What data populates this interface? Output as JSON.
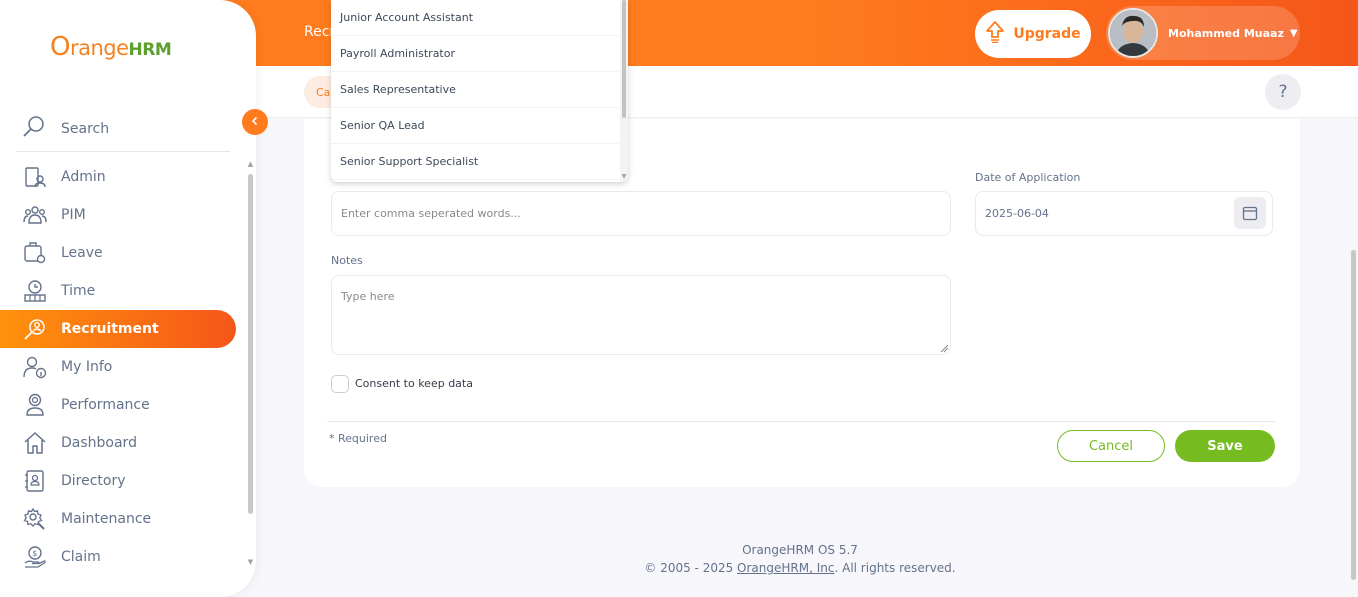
{
  "topbar": {
    "title": "Recr",
    "upgrade_label": "Upgrade",
    "user_name": "Mohammed Muaaz",
    "accent": "#ff7b1d"
  },
  "subbar": {
    "chip_label": "Ca",
    "help_label": "?"
  },
  "sidebar": {
    "logo_o": "O",
    "logo_range": "range",
    "logo_hrm": "HRM",
    "search_label": "Search",
    "items": [
      {
        "label": "Admin",
        "icon": "admin-icon"
      },
      {
        "label": "PIM",
        "icon": "pim-icon"
      },
      {
        "label": "Leave",
        "icon": "leave-icon"
      },
      {
        "label": "Time",
        "icon": "time-icon"
      },
      {
        "label": "Recruitment",
        "icon": "recruitment-icon",
        "active": true
      },
      {
        "label": "My Info",
        "icon": "my-info-icon"
      },
      {
        "label": "Performance",
        "icon": "performance-icon"
      },
      {
        "label": "Dashboard",
        "icon": "dashboard-icon"
      },
      {
        "label": "Directory",
        "icon": "directory-icon"
      },
      {
        "label": "Maintenance",
        "icon": "maintenance-icon"
      },
      {
        "label": "Claim",
        "icon": "claim-icon"
      }
    ]
  },
  "dropdown": {
    "options": [
      "Junior Account Assistant",
      "Payroll Administrator",
      "Sales Representative",
      "Senior QA Lead",
      "Senior Support Specialist"
    ]
  },
  "form": {
    "keywords_placeholder": "Enter comma seperated words...",
    "date_label": "Date of Application",
    "date_value": "2025-06-04",
    "notes_label": "Notes",
    "notes_placeholder": "Type here",
    "consent_label": "Consent to keep data",
    "required_note": "* Required",
    "cancel_label": "Cancel",
    "save_label": "Save"
  },
  "footer": {
    "version": "OrangeHRM OS 5.7",
    "copyright_prefix": "© 2005 - 2025 ",
    "company_link": "OrangeHRM, Inc",
    "copyright_suffix": ". All rights reserved."
  }
}
